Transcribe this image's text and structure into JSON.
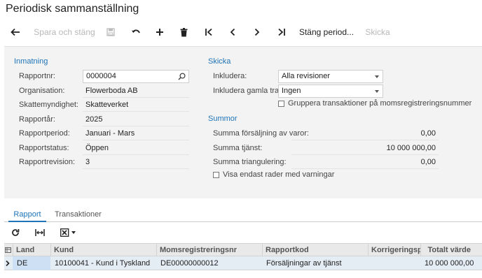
{
  "page": {
    "title": "Periodisk sammanställning"
  },
  "toolbar": {
    "save_close": "Spara och stäng",
    "close_period": "Stäng period...",
    "send": "Skicka"
  },
  "inmatning": {
    "title": "Inmatning",
    "fields": [
      {
        "label": "Rapportnr:",
        "value": "0000004"
      },
      {
        "label": "Organisation:",
        "value": "Flowerboda AB"
      },
      {
        "label": "Skattemyndighet:",
        "value": "Skatteverket"
      },
      {
        "label": "Rapportår:",
        "value": "2025"
      },
      {
        "label": "Rapportperiod:",
        "value": "Januari - Mars"
      },
      {
        "label": "Rapportstatus:",
        "value": "Öppen"
      },
      {
        "label": "Rapportrevision:",
        "value": "3"
      }
    ]
  },
  "skicka": {
    "title": "Skicka",
    "include_label": "Inkludera:",
    "include_value": "Alla revisioner",
    "include_old_label": "Inkludera gamla tra...",
    "include_old_value": "Ingen",
    "group_checkbox": "Gruppera transaktioner på momsregistreringsnummer"
  },
  "summor": {
    "title": "Summor",
    "rows": [
      {
        "label": "Summa försäljning av varor:",
        "value": "0,00"
      },
      {
        "label": "Summa tjänst:",
        "value": "10 000 000,00"
      },
      {
        "label": "Summa triangulering:",
        "value": "0,00"
      }
    ],
    "warnings_checkbox": "Visa endast rader med varningar"
  },
  "tabs": [
    {
      "label": "Rapport"
    },
    {
      "label": "Transaktioner"
    }
  ],
  "grid": {
    "columns": [
      "Land",
      "Kund",
      "Momsregistreringsnr",
      "Rapportkod",
      "Korrigeringsp",
      "Totalt värde"
    ],
    "rows": [
      {
        "land": "DE",
        "kund": "10100041 - Kund i Tyskland",
        "moms": "DE00000000012",
        "kod": "Försäljningar av tjänst",
        "korr": "",
        "totalt": "10 000 000,00"
      }
    ]
  },
  "colors": {
    "accent": "#1f74b8",
    "panel_bg": "#f3f3f3",
    "selected_row": "#e4ecf4",
    "selected_cell": "#cde0f4"
  }
}
